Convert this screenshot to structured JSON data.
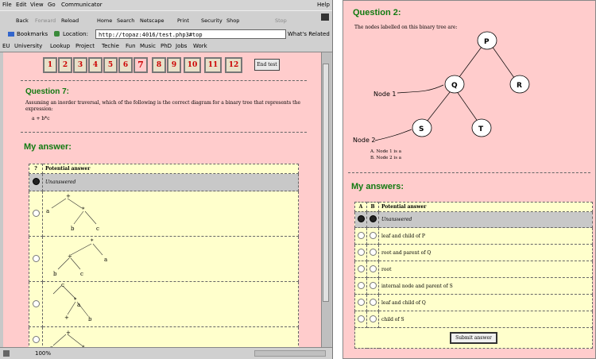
{
  "left": {
    "menu": [
      "File",
      "Edit",
      "View",
      "Go",
      "Communicator",
      "Help"
    ],
    "toolbar": [
      "Back",
      "Forward",
      "Reload",
      "Home",
      "Search",
      "Netscape",
      "Print",
      "Security",
      "Shop",
      "Stop"
    ],
    "bookmarks_label": "Bookmarks",
    "location_label": "Location:",
    "location_value": "http://topaz:4016/test.php3#top",
    "whats_related": "What's Related",
    "links": [
      "EU",
      "University",
      "Lookup",
      "Project",
      "Techie",
      "Fun",
      "Music",
      "PhD",
      "Jobs",
      "Work"
    ],
    "question_buttons": [
      "1",
      "2",
      "3",
      "4",
      "5",
      "6",
      "7",
      "8",
      "9",
      "10",
      "11",
      "12"
    ],
    "end_test_label": "End test",
    "question_title": "Question 7:",
    "question_text": "Assuming an inorder traversal, which of the following is the correct diagram for a binary tree that represents the expression:",
    "expression": "a + b*c",
    "answer_title": "My answer:",
    "table_headers": [
      "?",
      "Potential answer"
    ],
    "unanswered": "Unanswered",
    "tree_labels": {
      "t1": [
        "+",
        "a",
        "*",
        "b",
        "c"
      ],
      "t2": [
        "*",
        "+",
        "a",
        "b",
        "c"
      ],
      "t3": [
        "c",
        "*",
        "a",
        "+",
        "b"
      ],
      "t4": [
        "+",
        "a",
        "*"
      ]
    },
    "status_percent": "100%"
  },
  "right": {
    "question_title": "Question 2:",
    "question_text": "The nodes labelled on this binary tree are:",
    "tree_nodes": [
      "P",
      "Q",
      "R",
      "S",
      "T"
    ],
    "node1_label": "Node 1",
    "node2_label": "Node 2",
    "options": [
      "A. Node 1 is a",
      "B. Node 2 is a"
    ],
    "answers_title": "My answers:",
    "table_headers": [
      "A",
      "B",
      "Potential answer"
    ],
    "unanswered": "Unanswered",
    "rows": [
      "leaf and child of P",
      "root and parent of Q",
      "root",
      "internal node and parent of S",
      "leaf and child of Q",
      "child of S"
    ],
    "submit_label": "Submit answer"
  }
}
